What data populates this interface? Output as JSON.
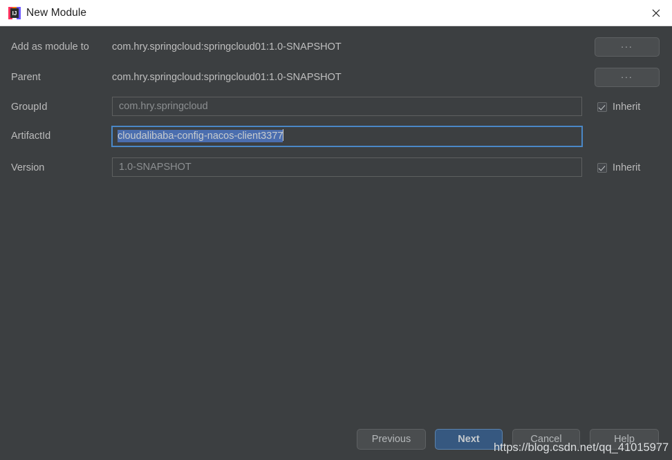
{
  "window": {
    "title": "New Module",
    "icon": "intellij-idea-icon",
    "close_icon": "close-icon",
    "titlebar_bg": "#ffffff",
    "body_bg": "#3c3f41"
  },
  "form": {
    "rows": [
      {
        "key": "add-as-module-to",
        "label": "Add as module to",
        "type": "static",
        "value": "com.hry.springcloud:springcloud01:1.0-SNAPSHOT",
        "browse_label": "...",
        "has_browse": true,
        "has_inherit": false
      },
      {
        "key": "parent",
        "label": "Parent",
        "type": "static",
        "value": "com.hry.springcloud:springcloud01:1.0-SNAPSHOT",
        "browse_label": "...",
        "has_browse": true,
        "has_inherit": false
      },
      {
        "key": "groupid",
        "label": "GroupId",
        "type": "input",
        "value": "com.hry.springcloud",
        "focused": false,
        "has_browse": false,
        "has_inherit": true,
        "inherit_label": "Inherit",
        "inherit_checked": true
      },
      {
        "key": "artifactid",
        "label": "ArtifactId",
        "type": "input",
        "value": "cloudalibaba-config-nacos-client3377",
        "focused": true,
        "selected": true,
        "has_browse": false,
        "has_inherit": false
      },
      {
        "key": "version",
        "label": "Version",
        "type": "input",
        "value": "1.0-SNAPSHOT",
        "focused": false,
        "has_browse": false,
        "has_inherit": true,
        "inherit_label": "Inherit",
        "inherit_checked": true
      }
    ]
  },
  "footer": {
    "buttons": [
      {
        "key": "previous",
        "label": "Previous",
        "default": false
      },
      {
        "key": "next",
        "label": "Next",
        "default": true
      },
      {
        "key": "cancel",
        "label": "Cancel",
        "default": false
      },
      {
        "key": "help",
        "label": "Help",
        "default": false
      }
    ],
    "accent_color": "#365880"
  },
  "watermark": {
    "text": "https://blog.csdn.net/qq_41015977"
  }
}
